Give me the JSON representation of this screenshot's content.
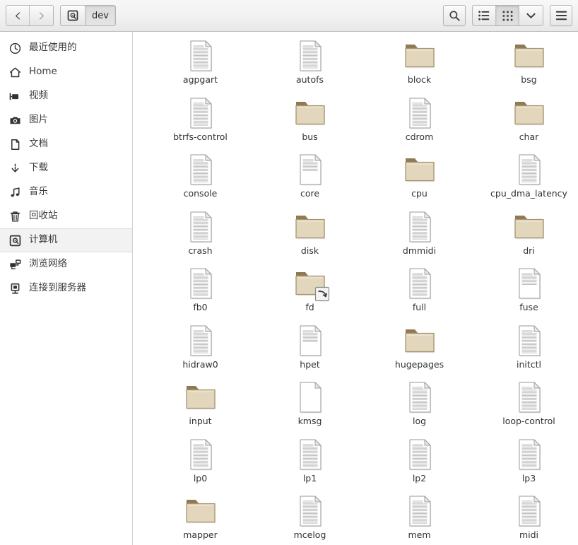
{
  "window": {
    "title": "dev"
  },
  "toolbar": {
    "back": {
      "name": "back-button",
      "icon": "chevron-left-icon",
      "label": "‹"
    },
    "forward": {
      "name": "forward-button",
      "icon": "chevron-right-icon",
      "label": "›"
    },
    "breadcrumbs": [
      {
        "label": "",
        "icon": "computer-icon",
        "pressed": false
      },
      {
        "label": "dev",
        "icon": "",
        "pressed": true
      }
    ],
    "search": {
      "label": "",
      "icon": "search-icon"
    },
    "view_list": {
      "label": "",
      "icon": "list-view-icon",
      "active": false
    },
    "view_grid": {
      "label": "",
      "icon": "grid-view-icon",
      "active": true
    },
    "view_options": {
      "label": "",
      "icon": "chevron-down-icon"
    },
    "menu": {
      "label": "",
      "icon": "hamburger-menu-icon"
    }
  },
  "sidebar": {
    "items": [
      {
        "label": "最近使用的",
        "icon": "clock-icon",
        "selected": false
      },
      {
        "label": "Home",
        "icon": "home-icon",
        "selected": false
      },
      {
        "label": "视频",
        "icon": "video-icon",
        "selected": false
      },
      {
        "label": "图片",
        "icon": "camera-icon",
        "selected": false
      },
      {
        "label": "文档",
        "icon": "document-icon",
        "selected": false
      },
      {
        "label": "下载",
        "icon": "download-icon",
        "selected": false
      },
      {
        "label": "音乐",
        "icon": "music-note-icon",
        "selected": false
      },
      {
        "label": "回收站",
        "icon": "trash-icon",
        "selected": false
      },
      {
        "label": "计算机",
        "icon": "computer-icon",
        "selected": true
      },
      {
        "label": "浏览网络",
        "icon": "network-icon",
        "selected": false
      },
      {
        "label": "连接到服务器",
        "icon": "server-connect-icon",
        "selected": false
      }
    ]
  },
  "files": [
    {
      "name": "agpgart",
      "type": "file",
      "lines": "full"
    },
    {
      "name": "autofs",
      "type": "file",
      "lines": "full"
    },
    {
      "name": "block",
      "type": "folder",
      "lines": ""
    },
    {
      "name": "bsg",
      "type": "folder",
      "lines": ""
    },
    {
      "name": "btrfs-control",
      "type": "file",
      "lines": "full"
    },
    {
      "name": "bus",
      "type": "folder",
      "lines": ""
    },
    {
      "name": "cdrom",
      "type": "file",
      "lines": "full"
    },
    {
      "name": "char",
      "type": "folder",
      "lines": ""
    },
    {
      "name": "console",
      "type": "file",
      "lines": "full"
    },
    {
      "name": "core",
      "type": "file",
      "lines": "half"
    },
    {
      "name": "cpu",
      "type": "folder",
      "lines": ""
    },
    {
      "name": "cpu_dma_latency",
      "type": "file",
      "lines": "full"
    },
    {
      "name": "crash",
      "type": "file",
      "lines": "full"
    },
    {
      "name": "disk",
      "type": "folder",
      "lines": ""
    },
    {
      "name": "dmmidi",
      "type": "file",
      "lines": "full"
    },
    {
      "name": "dri",
      "type": "folder",
      "lines": ""
    },
    {
      "name": "fb0",
      "type": "file",
      "lines": "full"
    },
    {
      "name": "fd",
      "type": "folder",
      "lines": "",
      "emblem": "symlink-emblem"
    },
    {
      "name": "full",
      "type": "file",
      "lines": "full"
    },
    {
      "name": "fuse",
      "type": "file",
      "lines": "half"
    },
    {
      "name": "hidraw0",
      "type": "file",
      "lines": "full"
    },
    {
      "name": "hpet",
      "type": "file",
      "lines": "half"
    },
    {
      "name": "hugepages",
      "type": "folder",
      "lines": ""
    },
    {
      "name": "initctl",
      "type": "file",
      "lines": "full"
    },
    {
      "name": "input",
      "type": "folder",
      "lines": ""
    },
    {
      "name": "kmsg",
      "type": "file",
      "lines": "none"
    },
    {
      "name": "log",
      "type": "file",
      "lines": "full"
    },
    {
      "name": "loop-control",
      "type": "file",
      "lines": "full"
    },
    {
      "name": "lp0",
      "type": "file",
      "lines": "full"
    },
    {
      "name": "lp1",
      "type": "file",
      "lines": "full"
    },
    {
      "name": "lp2",
      "type": "file",
      "lines": "full"
    },
    {
      "name": "lp3",
      "type": "file",
      "lines": "full"
    },
    {
      "name": "mapper",
      "type": "folder",
      "lines": ""
    },
    {
      "name": "mcelog",
      "type": "file",
      "lines": "full"
    },
    {
      "name": "mem",
      "type": "file",
      "lines": "full"
    },
    {
      "name": "midi",
      "type": "file",
      "lines": "full"
    }
  ],
  "colors": {
    "folder_body": "#e2d7bd",
    "folder_tab": "#8f7a55",
    "folder_edge": "#a8946c",
    "file_body": "#ffffff",
    "file_edge": "#9a9a9a",
    "toolbar_top": "#f7f7f7",
    "toolbar_bottom": "#e8e8e8",
    "text": "#2e3436",
    "selected_row": "#f2f2f2"
  }
}
